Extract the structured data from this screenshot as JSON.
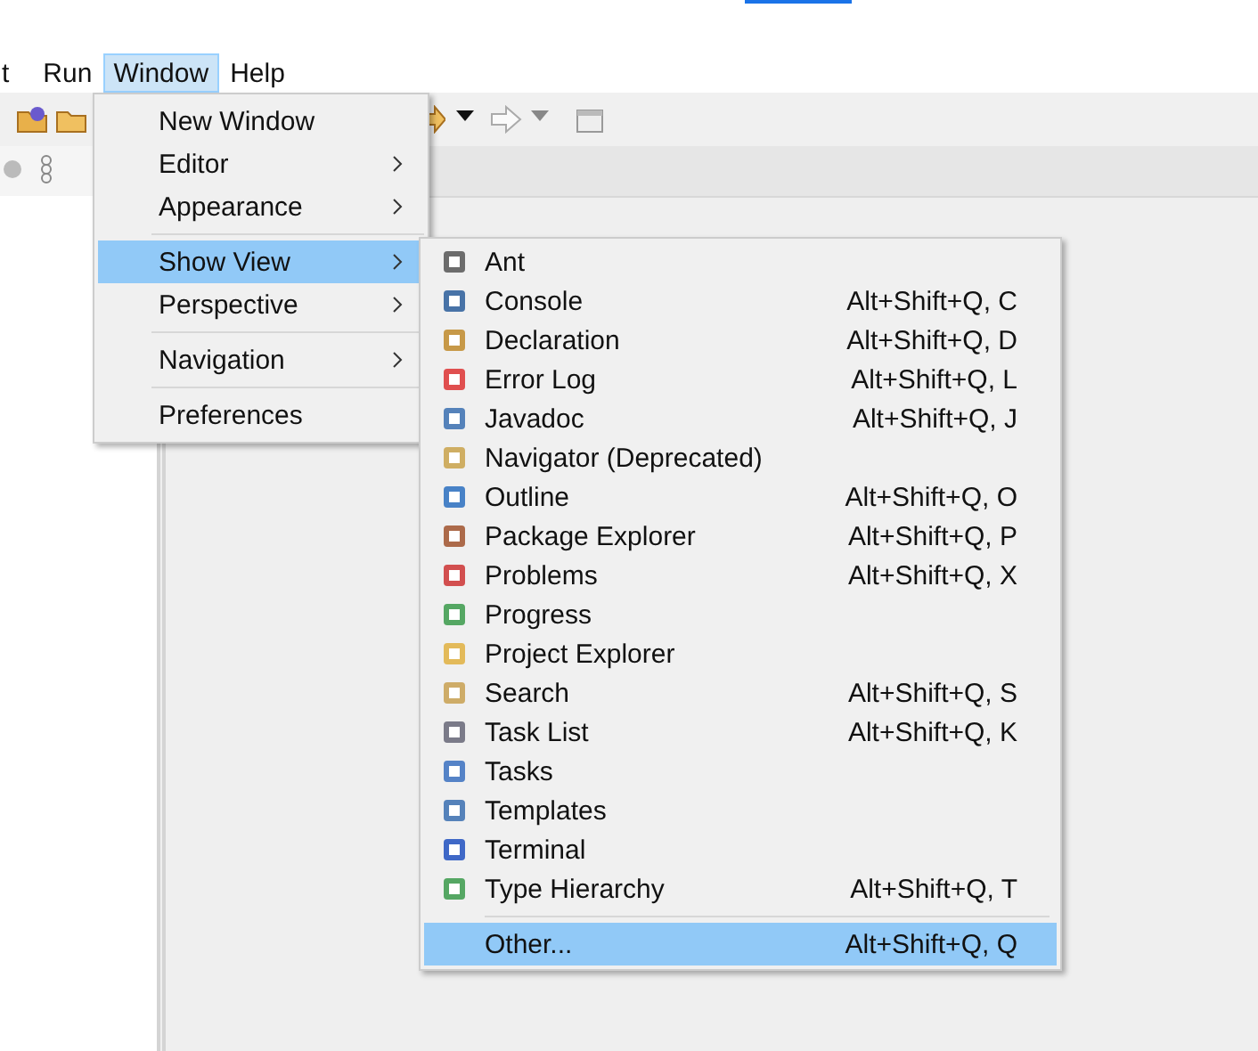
{
  "menubar": [
    {
      "label": "t",
      "selected": false
    },
    {
      "label": "Run",
      "selected": false
    },
    {
      "label": "Window",
      "selected": true
    },
    {
      "label": "Help",
      "selected": false
    }
  ],
  "window_menu": {
    "items": [
      {
        "kind": "item",
        "label": "New Window",
        "submenu": false,
        "selected": false
      },
      {
        "kind": "item",
        "label": "Editor",
        "submenu": true,
        "selected": false
      },
      {
        "kind": "item",
        "label": "Appearance",
        "submenu": true,
        "selected": false
      },
      {
        "kind": "separator"
      },
      {
        "kind": "item",
        "label": "Show View",
        "submenu": true,
        "selected": true
      },
      {
        "kind": "item",
        "label": "Perspective",
        "submenu": true,
        "selected": false
      },
      {
        "kind": "separator"
      },
      {
        "kind": "item",
        "label": "Navigation",
        "submenu": true,
        "selected": false
      },
      {
        "kind": "separator"
      },
      {
        "kind": "item",
        "label": "Preferences",
        "submenu": false,
        "selected": false
      }
    ]
  },
  "show_view_menu": {
    "items": [
      {
        "kind": "item",
        "label": "Ant",
        "selected": false
      },
      {
        "kind": "item",
        "label": "Console",
        "shortcut": "Alt+Shift+Q, C",
        "selected": false
      },
      {
        "kind": "item",
        "label": "Declaration",
        "shortcut": "Alt+Shift+Q, D",
        "selected": false
      },
      {
        "kind": "item",
        "label": "Error Log",
        "shortcut": "Alt+Shift+Q, L",
        "selected": false
      },
      {
        "kind": "item",
        "label": "Javadoc",
        "shortcut": "Alt+Shift+Q, J",
        "selected": false
      },
      {
        "kind": "item",
        "label": "Navigator (Deprecated)",
        "selected": false
      },
      {
        "kind": "item",
        "label": "Outline",
        "shortcut": "Alt+Shift+Q, O",
        "selected": false
      },
      {
        "kind": "item",
        "label": "Package Explorer",
        "shortcut": "Alt+Shift+Q, P",
        "selected": false
      },
      {
        "kind": "item",
        "label": "Problems",
        "shortcut": "Alt+Shift+Q, X",
        "selected": false
      },
      {
        "kind": "item",
        "label": "Progress",
        "selected": false
      },
      {
        "kind": "item",
        "label": "Project Explorer",
        "selected": false
      },
      {
        "kind": "item",
        "label": "Search",
        "shortcut": "Alt+Shift+Q, S",
        "selected": false
      },
      {
        "kind": "item",
        "label": "Task List",
        "shortcut": "Alt+Shift+Q, K",
        "selected": false
      },
      {
        "kind": "item",
        "label": "Tasks",
        "selected": false
      },
      {
        "kind": "item",
        "label": "Templates",
        "selected": false
      },
      {
        "kind": "item",
        "label": "Terminal",
        "selected": false
      },
      {
        "kind": "item",
        "label": "Type Hierarchy",
        "shortcut": "Alt+Shift+Q, T",
        "selected": false
      },
      {
        "kind": "separator"
      },
      {
        "kind": "item",
        "label": "Other...",
        "shortcut": "Alt+Shift+Q, Q",
        "selected": true
      }
    ]
  }
}
